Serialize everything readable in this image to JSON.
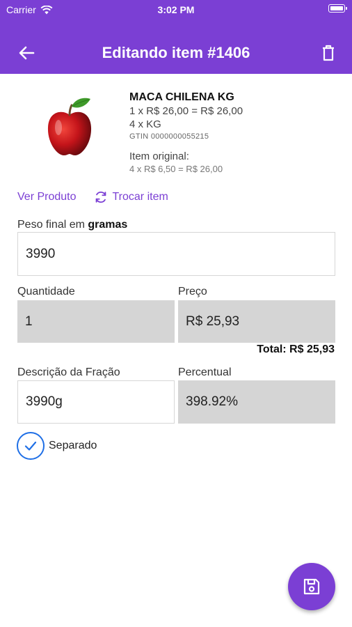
{
  "status_bar": {
    "carrier": "Carrier",
    "time": "3:02 PM"
  },
  "header": {
    "title": "Editando item #1406"
  },
  "product": {
    "name": "MACA CHILENA KG",
    "price_line": "1 x R$ 26,00 = R$ 26,00",
    "qty_line": "4 x KG",
    "gtin": "GTIN 0000000055215",
    "original_label": "Item original:",
    "original_line": "4 x R$ 6,50 = R$ 26,00"
  },
  "links": {
    "view_product": "Ver Produto",
    "swap_item": "Trocar item"
  },
  "form": {
    "weight_label_prefix": "Peso final em ",
    "weight_label_unit": "gramas",
    "weight_value": "3990",
    "quantity_label": "Quantidade",
    "quantity_value": "1",
    "price_label": "Preço",
    "price_value": "R$ 25,93",
    "total": "Total: R$ 25,93",
    "fraction_label": "Descrição da Fração",
    "fraction_value": "3990g",
    "percent_label": "Percentual",
    "percent_value": "398.92%",
    "separated_label": "Separado",
    "separated_checked": true
  },
  "colors": {
    "primary": "#7b3fd4",
    "checkbox": "#1f6fe6",
    "readonly_field": "#d5d5d5"
  },
  "icons": {
    "back": "arrow-left-icon",
    "delete": "trash-icon",
    "swap": "swap-icon",
    "check": "check-icon",
    "save": "save-icon",
    "product_image": "apple-image"
  }
}
